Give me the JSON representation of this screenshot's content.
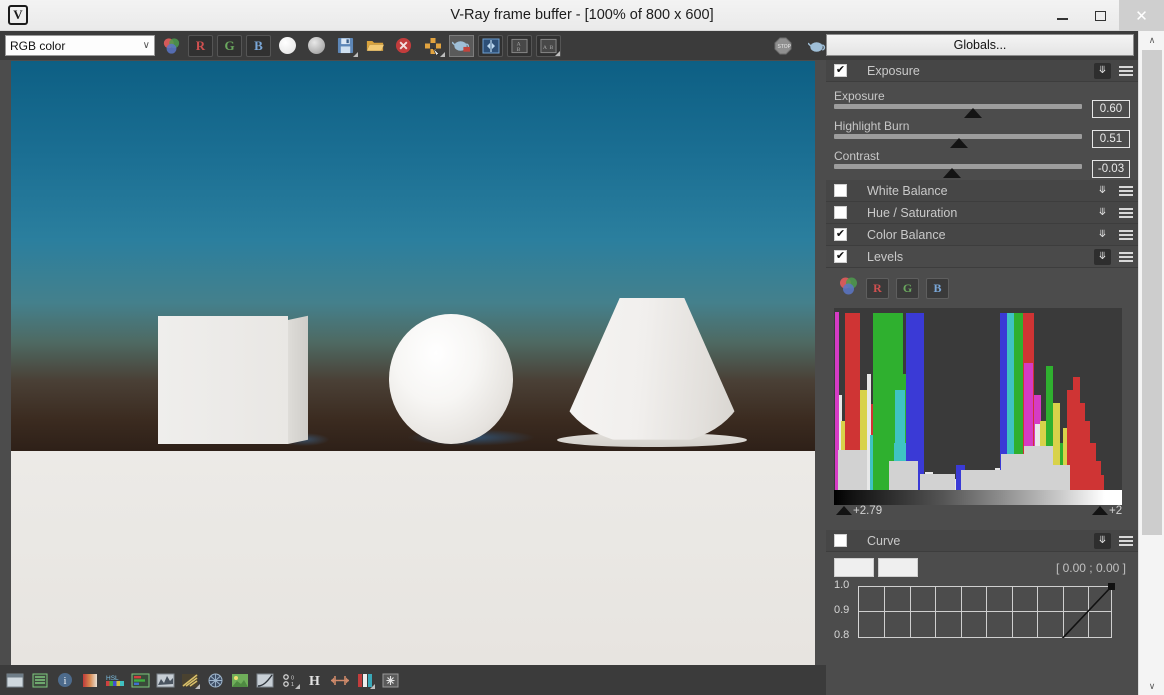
{
  "window": {
    "title": "V-Ray frame buffer - [100% of 800 x 600]",
    "app_icon": "vray-logo-icon",
    "minimize": "–",
    "maximize": "□",
    "close": "✕"
  },
  "toolbar": {
    "channel_select": {
      "value": "RGB color",
      "chevron": "∨"
    },
    "buttons": [
      {
        "name": "rgb-color-channel-button",
        "label": "",
        "icon": "color-venn-icon"
      },
      {
        "name": "red-channel-button",
        "label": "R",
        "color": "#d05050"
      },
      {
        "name": "green-channel-button",
        "label": "G",
        "color": "#6aa85e"
      },
      {
        "name": "blue-channel-button",
        "label": "B",
        "color": "#7aa7d8"
      },
      {
        "name": "alpha-channel-button",
        "label": "",
        "icon": "white-circle-icon"
      },
      {
        "name": "monochrome-button",
        "label": "",
        "icon": "grey-circle-icon"
      },
      {
        "name": "save-image-button",
        "label": "",
        "icon": "floppy-save-icon"
      },
      {
        "name": "load-image-button",
        "label": "",
        "icon": "folder-open-icon"
      },
      {
        "name": "clear-image-button",
        "label": "",
        "icon": "red-x-icon"
      },
      {
        "name": "track-mouse-button",
        "label": "",
        "icon": "move-cross-icon"
      },
      {
        "name": "render-last-button",
        "label": "",
        "icon": "teapot-render-icon"
      },
      {
        "name": "ab-compare-button",
        "label": "",
        "icon": "horizontal-compare-icon"
      },
      {
        "name": "ab-vertical-button",
        "label": "",
        "icon": "ab-vertical-icon"
      },
      {
        "name": "ab-horizontal-button",
        "label": "",
        "icon": "ab-horizontal-icon"
      }
    ],
    "right_buttons": [
      {
        "name": "stop-render-button",
        "icon": "stop-sign-icon"
      },
      {
        "name": "render-button",
        "icon": "teapot-icon"
      }
    ],
    "globals_label": "Globals..."
  },
  "render_view": {
    "objects": [
      "box",
      "sphere",
      "cone"
    ],
    "sky_color": "#1c7094",
    "floor_color": "#eceae7"
  },
  "status_bar": {
    "icons": [
      "pixel-info-icon",
      "color-corrections-icon",
      "info-icon",
      "gradient-icon",
      "hsl-icon",
      "color-levels-icon",
      "curve-histogram-icon",
      "lut-icon",
      "srgb-icon",
      "icc-icon",
      "exposure-curve-icon",
      "ocio-icon",
      "hue-icon",
      "horizontal-flip-icon",
      "bars-icon",
      "denoise-icon"
    ]
  },
  "panel": {
    "sections": [
      {
        "name": "exposure",
        "title": "Exposure",
        "checked": true,
        "collapse_icon": "double-chevron-down-icon",
        "menu_icon": "hamburger-menu-icon",
        "sliders": [
          {
            "name": "exposure-slider",
            "label": "Exposure",
            "value": "0.60",
            "pos_pct": 57
          },
          {
            "name": "highlight-burn-slider",
            "label": "Highlight Burn",
            "value": "0.51",
            "pos_pct": 50
          },
          {
            "name": "contrast-slider",
            "label": "Contrast",
            "value": "-0.03",
            "pos_pct": 47
          }
        ]
      },
      {
        "name": "white-balance",
        "title": "White Balance",
        "checked": false
      },
      {
        "name": "hue-saturation",
        "title": "Hue / Saturation",
        "checked": false
      },
      {
        "name": "color-balance",
        "title": "Color Balance",
        "checked": true
      },
      {
        "name": "levels",
        "title": "Levels",
        "checked": true
      },
      {
        "name": "curve",
        "title": "Curve",
        "checked": false
      }
    ],
    "levels": {
      "channel_buttons": [
        {
          "name": "levels-rgb-button",
          "label": "",
          "icon": "color-venn-icon"
        },
        {
          "name": "levels-red-button",
          "label": "R",
          "color": "#d05050"
        },
        {
          "name": "levels-green-button",
          "label": "G",
          "color": "#6aa85e"
        },
        {
          "name": "levels-blue-button",
          "label": "B",
          "color": "#7aa7d8"
        }
      ],
      "black_point": "+2.79",
      "white_point": "+2"
    },
    "curve": {
      "coord_readout": "[ 0.00 ; 0.00 ]",
      "y_labels": [
        "1.0",
        "0.9",
        "0.8"
      ],
      "swatches": [
        "#efefef",
        "#efefef"
      ]
    }
  },
  "scrollbar": {
    "up": "∧",
    "down": "∨"
  }
}
